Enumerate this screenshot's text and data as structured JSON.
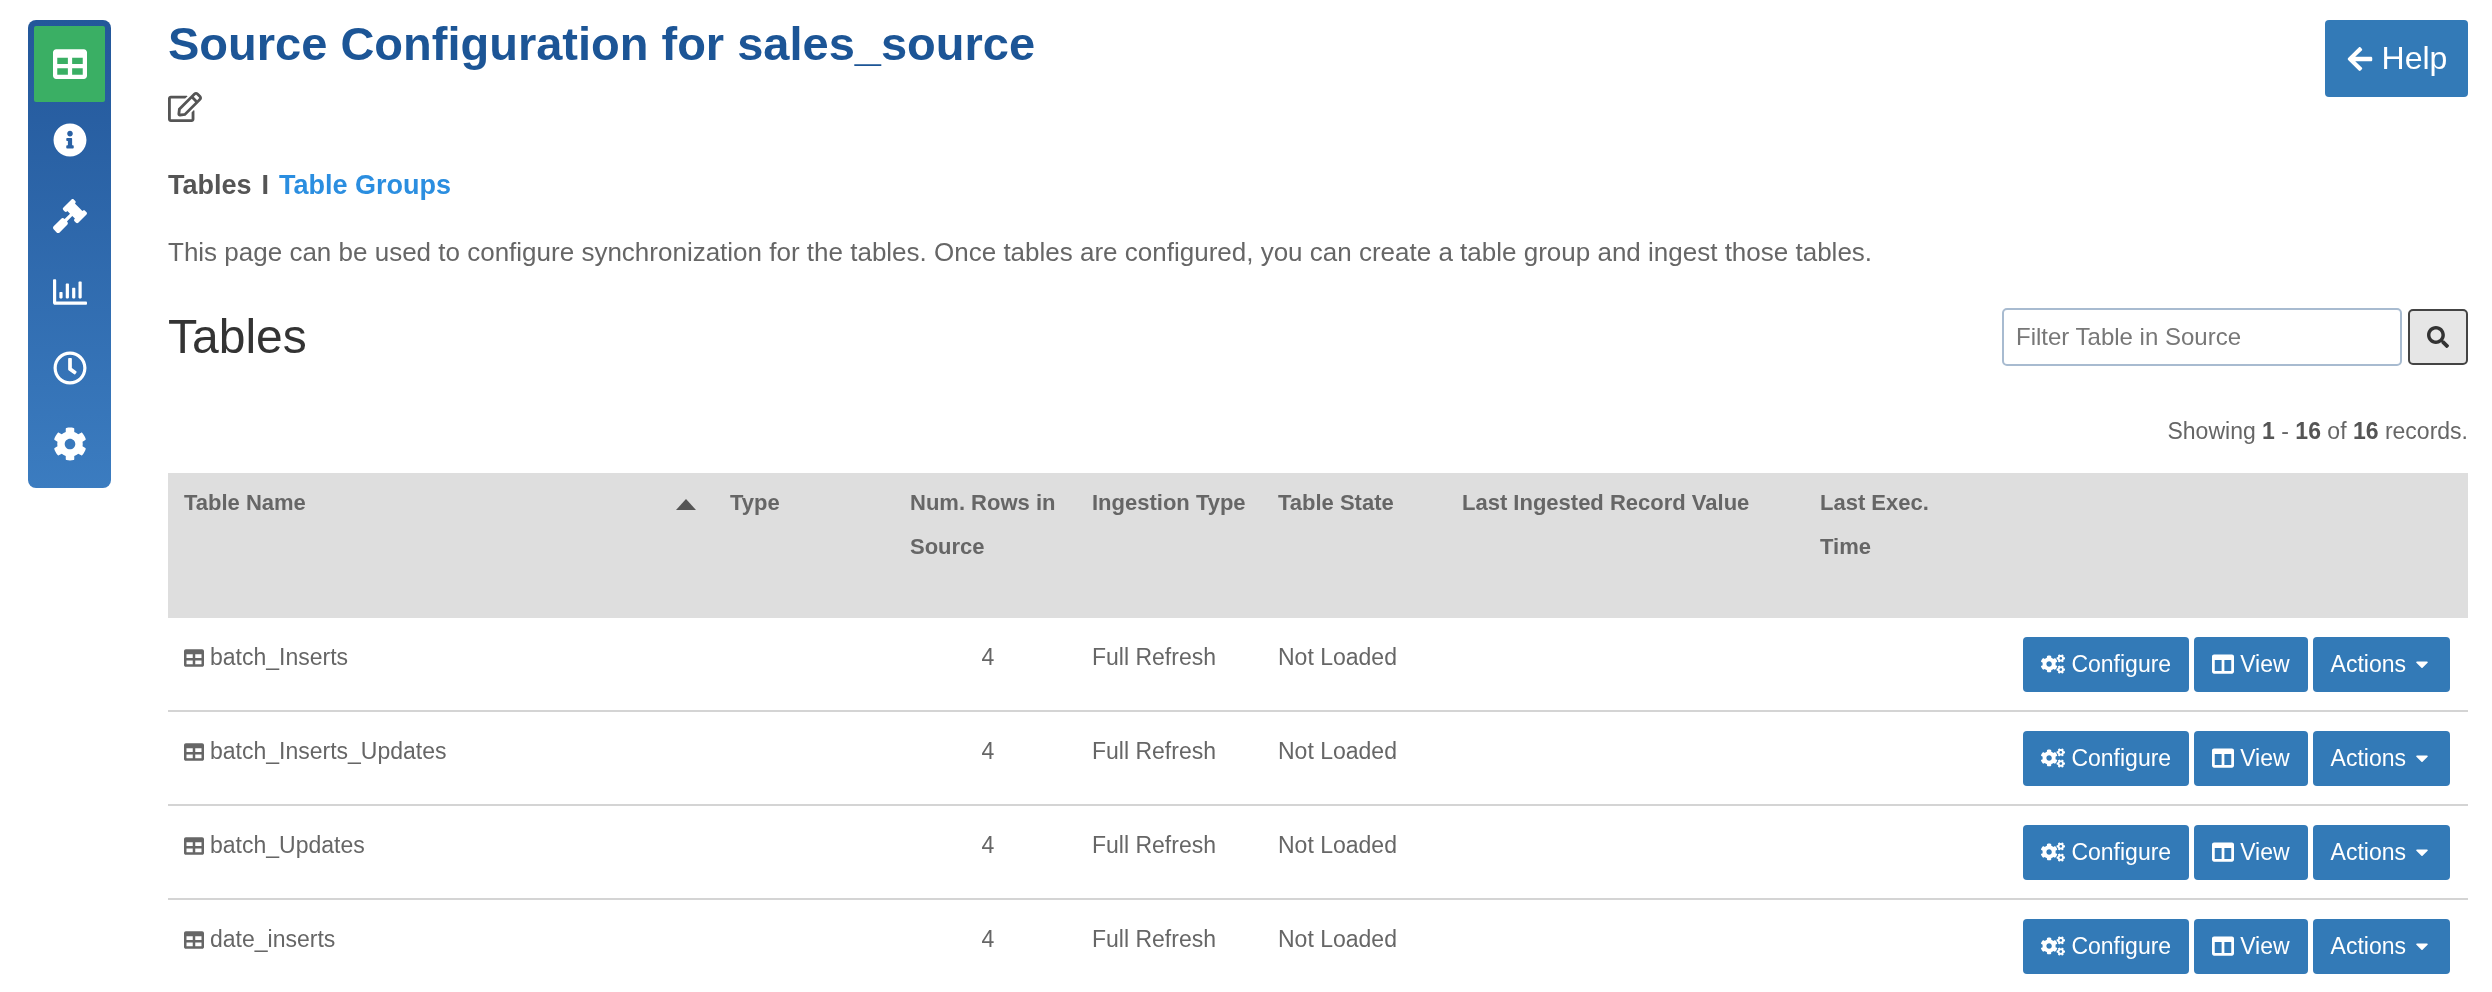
{
  "sidebar": {
    "items": [
      {
        "kind": "table",
        "selected": true
      },
      {
        "kind": "info",
        "selected": false
      },
      {
        "kind": "hammer",
        "selected": false
      },
      {
        "kind": "chart",
        "selected": false
      },
      {
        "kind": "clock",
        "selected": false
      },
      {
        "kind": "settings",
        "selected": false
      }
    ]
  },
  "page": {
    "title": "Source Configuration for sales_source",
    "help_button": "Help"
  },
  "subnav": [
    {
      "label": "Tables",
      "selected": true
    },
    {
      "label": "Table Groups",
      "selected": false
    }
  ],
  "subnav_separator": "I",
  "description": "This page can be used to configure synchronization for the tables. Once tables are configured, you can create a table group and ingest those tables.",
  "section_title": "Tables",
  "filter": {
    "placeholder": "Filter Table in Source"
  },
  "summary": "Showing **1** - **16** of **16** records.",
  "table": {
    "columns": [
      {
        "label": "Table Name",
        "sorted": true
      },
      {
        "label": "Type",
        "sorted": false
      },
      {
        "label": "Num. Rows in Source",
        "sorted": false
      },
      {
        "label": "Ingestion Type",
        "sorted": false
      },
      {
        "label": "Table State",
        "sorted": false
      },
      {
        "label": "Last Ingested Record Value",
        "sorted": false
      },
      {
        "label": "Last Exec. Time",
        "sorted": false
      }
    ],
    "rows": [
      {
        "name": "batch_Inserts",
        "num_rows": "4",
        "ingestion_type": "Full Refresh",
        "table_state": "Not Loaded",
        "actions": [
          {
            "kind": "configure",
            "label": "Configure"
          },
          {
            "kind": "view",
            "label": "View"
          },
          {
            "kind": "dropdown",
            "label": "Actions"
          }
        ]
      },
      {
        "name": "batch_Inserts_Updates",
        "num_rows": "4",
        "ingestion_type": "Full Refresh",
        "table_state": "Not Loaded",
        "actions": [
          {
            "kind": "configure",
            "label": "Configure"
          },
          {
            "kind": "view",
            "label": "View"
          },
          {
            "kind": "dropdown",
            "label": "Actions"
          }
        ]
      },
      {
        "name": "batch_Updates",
        "num_rows": "4",
        "ingestion_type": "Full Refresh",
        "table_state": "Not Loaded",
        "actions": [
          {
            "kind": "configure",
            "label": "Configure"
          },
          {
            "kind": "view",
            "label": "View"
          },
          {
            "kind": "dropdown",
            "label": "Actions"
          }
        ]
      },
      {
        "name": "date_inserts",
        "num_rows": "4",
        "ingestion_type": "Full Refresh",
        "table_state": "Not Loaded",
        "actions": [
          {
            "kind": "configure",
            "label": "Configure"
          },
          {
            "kind": "view",
            "label": "View"
          },
          {
            "kind": "dropdown",
            "label": "Actions"
          }
        ]
      }
    ]
  }
}
